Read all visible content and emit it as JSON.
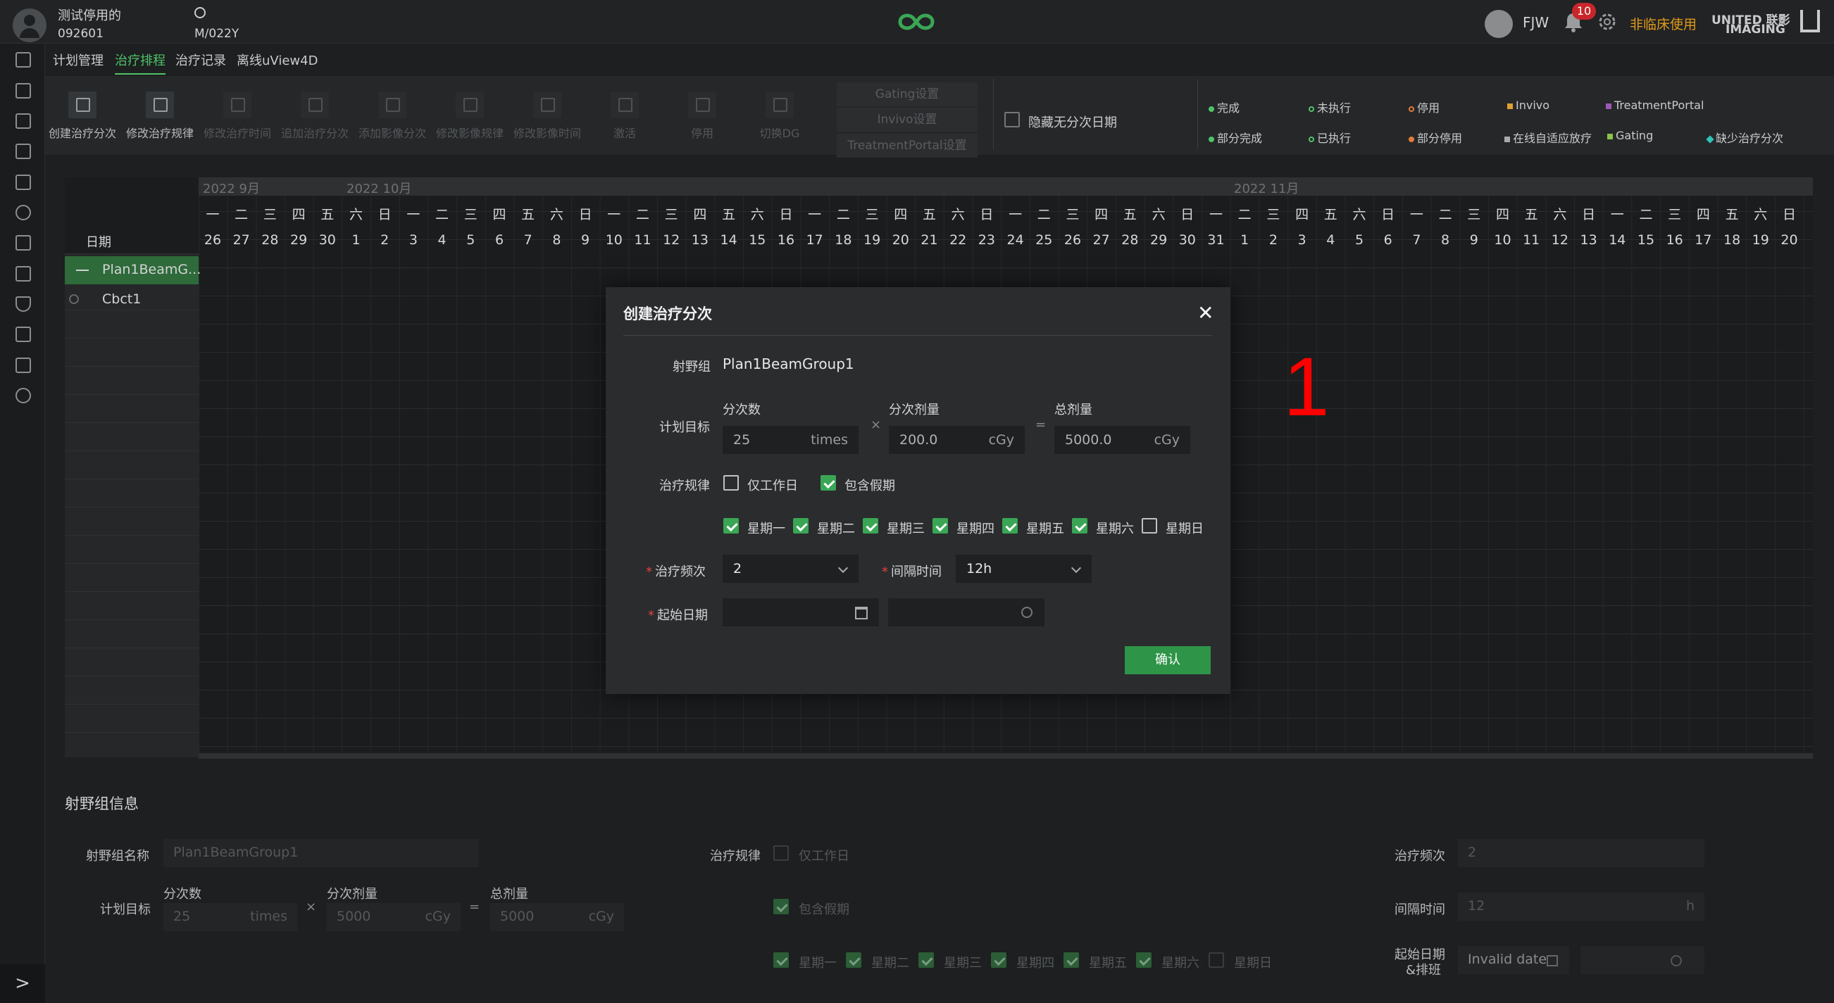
{
  "header": {
    "patient_name": "测试停用的",
    "patient_id": "092601",
    "search_sub": "M/022Y",
    "user": "FJW",
    "notifications": "10",
    "mode": "非临床使用",
    "brand": "UNITED 联影",
    "brand2": "IMAGING"
  },
  "tabs": [
    "计划管理",
    "治疗排程",
    "治疗记录",
    "离线uView4D"
  ],
  "toolbar": [
    "创建治疗分次",
    "修改治疗规律",
    "修改治疗时间",
    "追加治疗分次",
    "添加影像分次",
    "修改影像规律",
    "修改影像时间",
    "激活",
    "停用",
    "切换DG"
  ],
  "settings": [
    "Gating设置",
    "Invivo设置",
    "TreatmentPortal设置"
  ],
  "hide_label": "隐藏无分次日期",
  "legend": [
    {
      "text": "完成",
      "color": "#4fc36a"
    },
    {
      "text": "未执行",
      "color": "#4fc36a"
    },
    {
      "text": "停用",
      "color": "#e07b39"
    },
    {
      "text": "Invivo",
      "color": "#e0a030"
    },
    {
      "text": "TreatmentPortal",
      "color": "#9b59b6"
    },
    {
      "text": "部分完成",
      "color": "#4fc36a"
    },
    {
      "text": "已执行",
      "color": "#4fc36a"
    },
    {
      "text": "部分停用",
      "color": "#e07b39"
    },
    {
      "text": "在线自适应放疗",
      "color": "#aaaaaa"
    },
    {
      "text": "Gating",
      "color": "#8bc34a"
    },
    {
      "text": "缺少治疗分次",
      "color": "#2ec4b6"
    }
  ],
  "calendar": {
    "months": [
      "2022 9月",
      "2022 10月",
      "2022 11月"
    ],
    "date_header": "日期",
    "weekdays": [
      "一",
      "二",
      "三",
      "四",
      "五",
      "六",
      "日"
    ],
    "days": [
      "26",
      "27",
      "28",
      "29",
      "30",
      "1",
      "2",
      "3",
      "4",
      "5",
      "6",
      "7",
      "8",
      "9",
      "10",
      "11",
      "12",
      "13",
      "14",
      "15",
      "16",
      "17",
      "18",
      "19",
      "20",
      "21",
      "22",
      "23",
      "24",
      "25",
      "26",
      "27",
      "28",
      "29",
      "30",
      "31",
      "1",
      "2",
      "3",
      "4",
      "5",
      "6",
      "7",
      "8",
      "9",
      "10",
      "11",
      "12",
      "13",
      "14",
      "15",
      "16",
      "17",
      "18",
      "19",
      "20"
    ],
    "rows": [
      "Plan1BeamG...",
      "Cbct1"
    ]
  },
  "dialog": {
    "title": "创建治疗分次",
    "close": "✕",
    "beam_group_label": "射野组",
    "beam_group_value": "Plan1BeamGroup1",
    "target_label": "计划目标",
    "fractions_label": "分次数",
    "fractions_value": "25",
    "fractions_unit": "times",
    "dose_label": "分次剂量",
    "dose_value": "200.0",
    "dose_unit": "cGy",
    "total_label": "总剂量",
    "total_value": "5000.0",
    "total_unit": "cGy",
    "times_sym": "×",
    "eq_sym": "=",
    "rule_label": "治疗规律",
    "workday_label": "仅工作日",
    "holiday_label": "包含假期",
    "weekdays": [
      {
        "name": "星期一",
        "on": true
      },
      {
        "name": "星期二",
        "on": true
      },
      {
        "name": "星期三",
        "on": true
      },
      {
        "name": "星期四",
        "on": true
      },
      {
        "name": "星期五",
        "on": true
      },
      {
        "name": "星期六",
        "on": true
      },
      {
        "name": "星期日",
        "on": false
      }
    ],
    "freq_label": "治疗频次",
    "freq_value": "2",
    "interval_label": "间隔时间",
    "interval_value": "12h",
    "start_label": "起始日期",
    "confirm": "确认"
  },
  "annotation": "1",
  "bottom": {
    "section_title": "射野组信息",
    "name_label": "射野组名称",
    "name_value": "Plan1BeamGroup1",
    "target_label": "计划目标",
    "fractions_label": "分次数",
    "fractions_value": "25",
    "fractions_unit": "times",
    "dose_label": "分次剂量",
    "dose_value": "5000",
    "dose_unit": "cGy",
    "total_label": "总剂量",
    "total_value": "5000",
    "total_unit": "cGy",
    "rule_label": "治疗规律",
    "workday_label": "仅工作日",
    "holiday_label": "包含假期",
    "weekdays": [
      "星期一",
      "星期二",
      "星期三",
      "星期四",
      "星期五",
      "星期六",
      "星期日"
    ],
    "freq_label": "治疗频次",
    "freq_value": "2",
    "interval_label": "间隔时间",
    "interval_value": "12",
    "interval_unit": "h",
    "start_label": "起始日期",
    "start_label2": "&排班",
    "start_value": "Invalid date"
  }
}
